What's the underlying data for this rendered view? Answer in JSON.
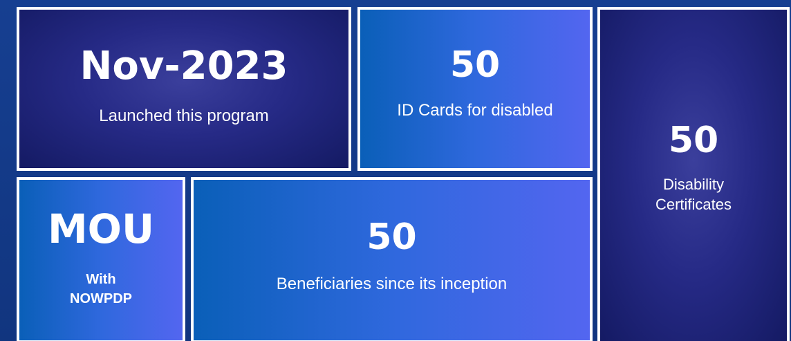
{
  "stats": [
    {
      "value": "Nov-2023",
      "caption_lines": [
        "Launched this program"
      ]
    },
    {
      "value": "50",
      "caption_lines": [
        "ID Cards for disabled"
      ]
    },
    {
      "value": "50",
      "caption_lines": [
        "Disability",
        "Certificates"
      ]
    },
    {
      "value": "MOU",
      "caption_lines": [
        "With",
        "NOWPDP"
      ]
    },
    {
      "value": "50",
      "caption_lines": [
        "Beneficiaries since its inception"
      ]
    }
  ],
  "colors": {
    "background": "#133a88",
    "tile_dark": "#1a1f6e",
    "tile_bright_start": "#0a5fb8",
    "tile_bright_end": "#5366f0",
    "border": "#ffffff",
    "text": "#ffffff"
  }
}
